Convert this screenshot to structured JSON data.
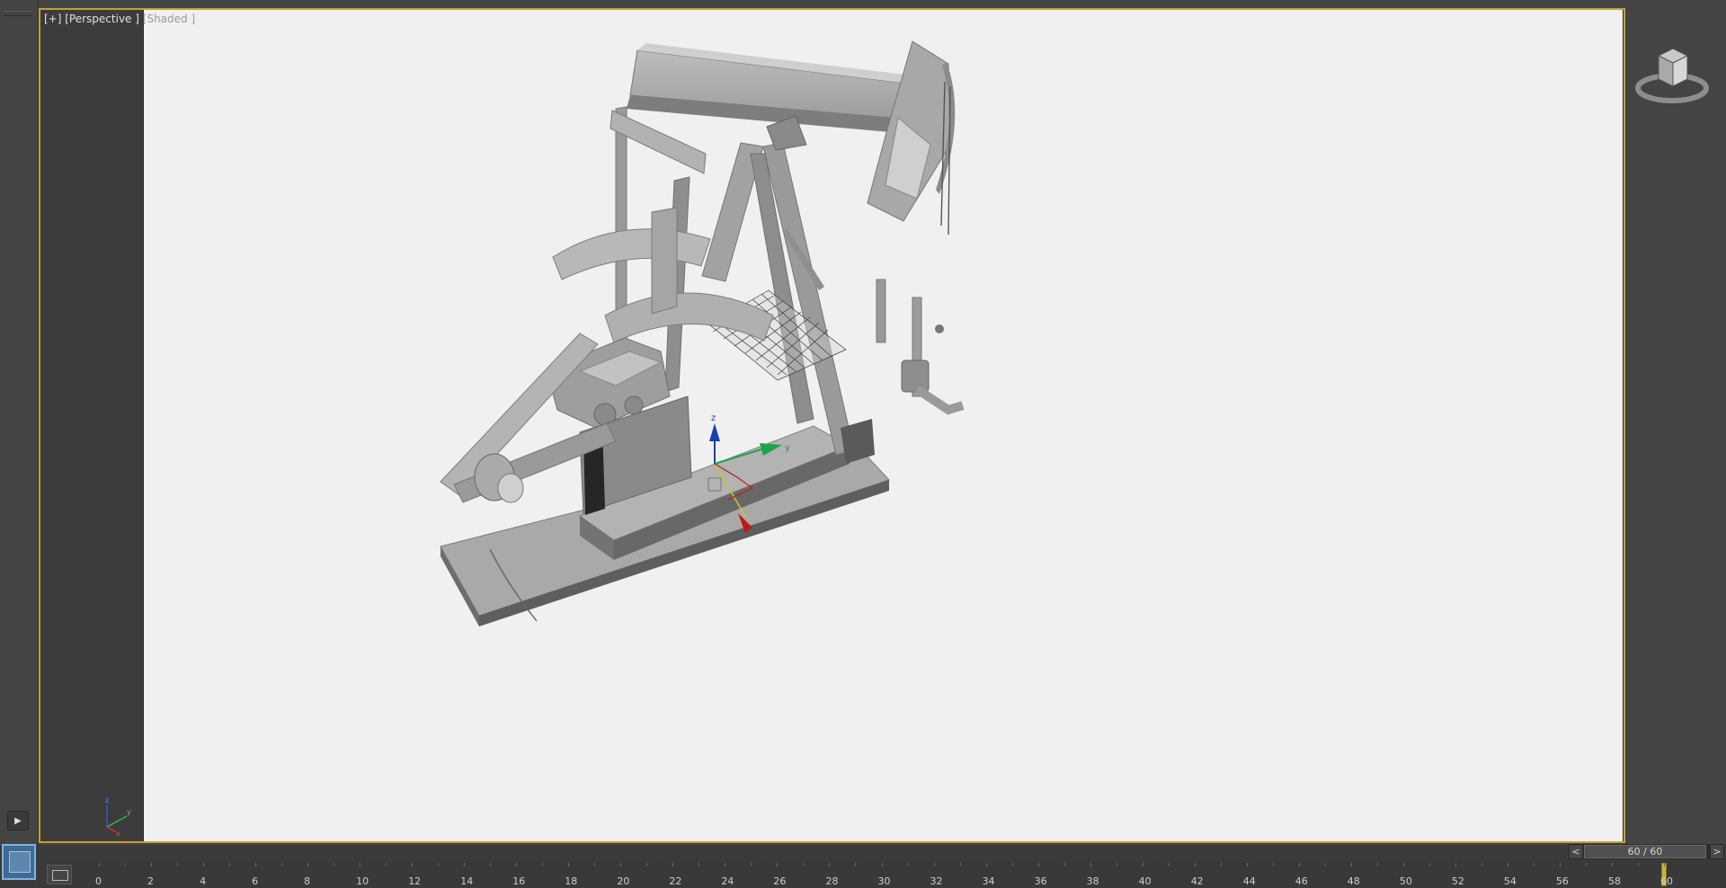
{
  "viewport": {
    "label_plus": "[+]",
    "label_view": "[Perspective ]",
    "label_shading": "[Shaded ]",
    "shading_color": "#9a9a9a"
  },
  "scene": {
    "object": "oil pumpjack 3D model",
    "background": "#f0f0f0",
    "gizmo_axes": [
      "z",
      "y"
    ]
  },
  "tripod": {
    "axes": [
      "z",
      "y",
      "x"
    ]
  },
  "timeline": {
    "slider_text": "60 / 60",
    "prev_label": "<",
    "next_label": ">",
    "current_frame": 60,
    "total_frames": 60,
    "tick_labels": [
      "0",
      "2",
      "4",
      "6",
      "8",
      "10",
      "12",
      "14",
      "16",
      "18",
      "20",
      "22",
      "24",
      "26",
      "28",
      "30",
      "32",
      "34",
      "36",
      "38",
      "40",
      "42",
      "44",
      "46",
      "48",
      "50",
      "52",
      "54",
      "56",
      "58",
      "60"
    ]
  },
  "colors": {
    "active_viewport_border": "#c6a22c",
    "ui_dark": "#444444",
    "selection_blue": "#3f6a93"
  },
  "icons": {
    "play": "play-icon",
    "viewcube": "viewcube-icon",
    "mini_curve": "mini-curve-editor-icon"
  }
}
